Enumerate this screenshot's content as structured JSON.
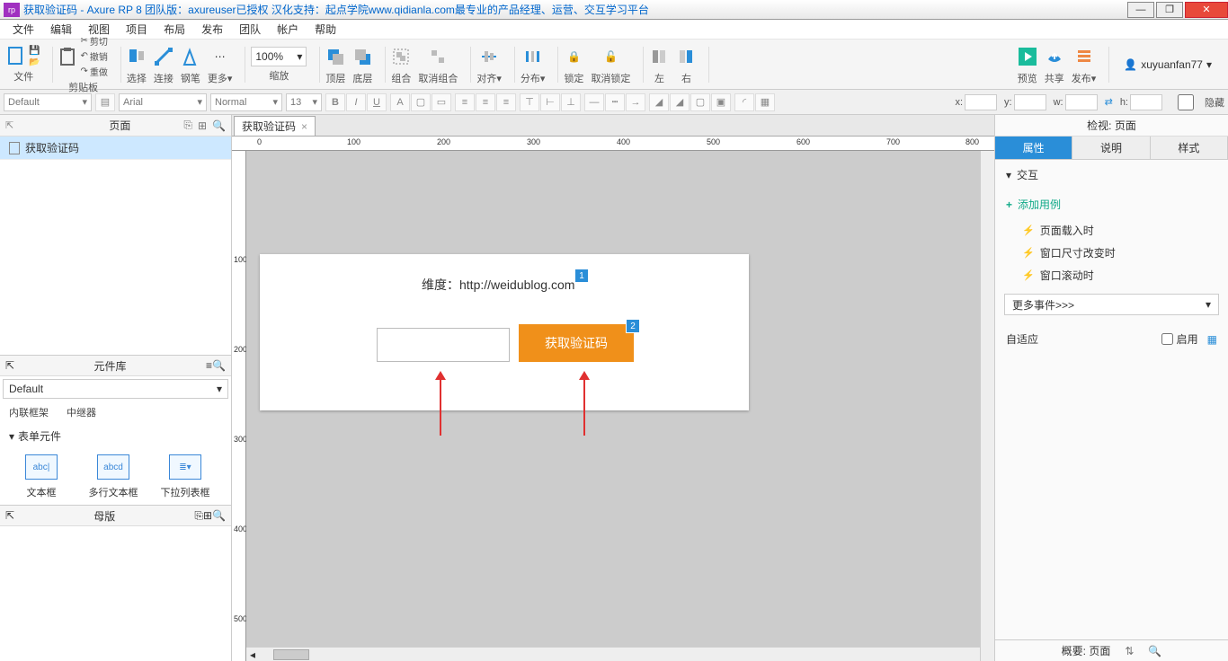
{
  "title": "获取验证码 - Axure RP 8 团队版：axureuser已授权 汉化支持：起点学院www.qidianla.com最专业的产品经理、运营、交互学习平台",
  "menu": [
    "文件",
    "编辑",
    "视图",
    "项目",
    "布局",
    "发布",
    "团队",
    "帐户",
    "帮助"
  ],
  "toolbar": {
    "file": "文件",
    "clipboard": "剪贴板",
    "select": "选择",
    "connect": "连接",
    "pen": "钢笔",
    "more": "更多▾",
    "zoom": "100%",
    "zoomLabel": "缩放",
    "top": "顶层",
    "bottom": "底层",
    "group": "组合",
    "ungroup": "取消组合",
    "align": "对齐▾",
    "distribute": "分布▾",
    "lock": "锁定",
    "unlock": "取消锁定",
    "left": "左",
    "right": "右",
    "preview": "预览",
    "share": "共享",
    "publish": "发布▾",
    "cut": "剪切",
    "undo": "撤销",
    "redo": "重做"
  },
  "user": "xuyuanfan77",
  "format": {
    "styleDefault": "Default",
    "font": "Arial",
    "weight": "Normal",
    "size": "13",
    "hidden": "隐藏"
  },
  "coords": {
    "x": "x:",
    "y": "y:",
    "w": "w:",
    "h": "h:"
  },
  "pages": {
    "title": "页面",
    "item": "获取验证码"
  },
  "library": {
    "title": "元件库",
    "selector": "Default",
    "row1a": "内联框架",
    "row1b": "中继器",
    "section": "表单元件",
    "w1": "文本框",
    "w2": "多行文本框",
    "w3": "下拉列表框"
  },
  "masters": {
    "title": "母版"
  },
  "tab": "获取验证码",
  "ruler_h": [
    "0",
    "100",
    "200",
    "300",
    "400",
    "500",
    "600",
    "700",
    "800"
  ],
  "ruler_v": [
    "100",
    "200",
    "300",
    "400",
    "500"
  ],
  "artboard": {
    "title": "维度：http://weidublog.com",
    "button": "获取验证码",
    "badge1": "1",
    "badge2": "2"
  },
  "inspector": {
    "header": "检视: 页面",
    "tabs": [
      "属性",
      "说明",
      "样式"
    ],
    "interaction": "交互",
    "addCase": "添加用例",
    "events": [
      "页面载入时",
      "窗口尺寸改变时",
      "窗口滚动时"
    ],
    "moreEvents": "更多事件>>>",
    "adaptive": "自适应",
    "enable": "启用"
  },
  "outline": "概要: 页面"
}
